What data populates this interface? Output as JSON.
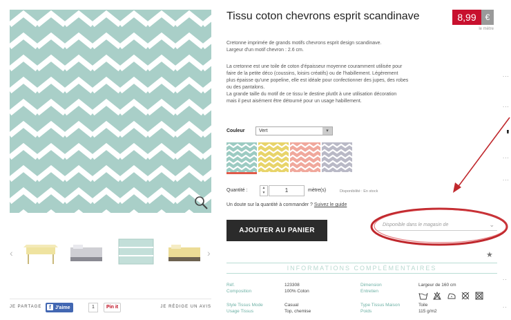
{
  "product": {
    "title": "Tissu coton chevrons esprit scandinave",
    "price": "8,99",
    "currency": "€",
    "price_unit": "le mètre",
    "desc_short_1": "Cretonne imprimée de grands motifs chevrons esprit design scandinave.",
    "desc_short_2": "Largeur d'un motif chevron : 2.6 cm.",
    "desc_long_1": "La cretonne est une toile de coton d'épaisseur moyenne couramment utilisée pour",
    "desc_long_2": "faire de la petite déco (coussins, loisirs créatifs) ou de l'habillement. Légèrement",
    "desc_long_3": "plus épaisse qu'une popeline, elle est idéale pour confectionner des jupes, des robes",
    "desc_long_4": "ou des pantalons.",
    "desc_long_5": "La grande taille du motif de ce tissu le destine plutôt à une utilisation décoration",
    "desc_long_6": "mais il peut aisément être détourné pour un usage habillement."
  },
  "options": {
    "color_label": "Couleur",
    "color_value": "Vert",
    "swatch_colors": [
      "#9ccbc2",
      "#e8d46a",
      "#f0a89c",
      "#b9b9c6"
    ]
  },
  "quantity": {
    "label": "Quantité :",
    "value": "1",
    "unit": "mètre(s)",
    "stock": "Disponibilité : En stock",
    "doubt_text": "Un doute sur la quantité à commander ?",
    "doubt_link": "Suivez le guide"
  },
  "cart": {
    "add_label": "AJOUTER AU PANIER",
    "store_placeholder": "Disponible dans le magasin de"
  },
  "share": {
    "label": "JE PARTAGE",
    "fb_label": "J'aime",
    "fb_count": "1",
    "pin_label": "Pin it",
    "review_label": "JE RÉDIGE UN AVIS"
  },
  "info": {
    "section_title": "INFORMATIONS COMPLÉMENTAIRES",
    "ref_key": "Réf.",
    "ref_val": "123308",
    "composition_key": "Composition",
    "composition_val": "100% Coton",
    "dimension_key": "Dimension",
    "dimension_val": "Largeur de 160 cm",
    "entretien_key": "Entretien",
    "style_key": "Style Tissus Mode",
    "style_val": "Casual",
    "usage_key": "Usage Tissus",
    "usage_val": "Top, chemise",
    "type_key": "Type Tissus Maison",
    "type_val": "Toile",
    "poids_key": "Poids",
    "poids_val": "115 g/m2"
  },
  "colors": {
    "chevron_bg": "#a9cfc8",
    "accent_red": "#c8102e",
    "info_teal": "#6db1a5",
    "annotation_red": "#c0282d"
  }
}
